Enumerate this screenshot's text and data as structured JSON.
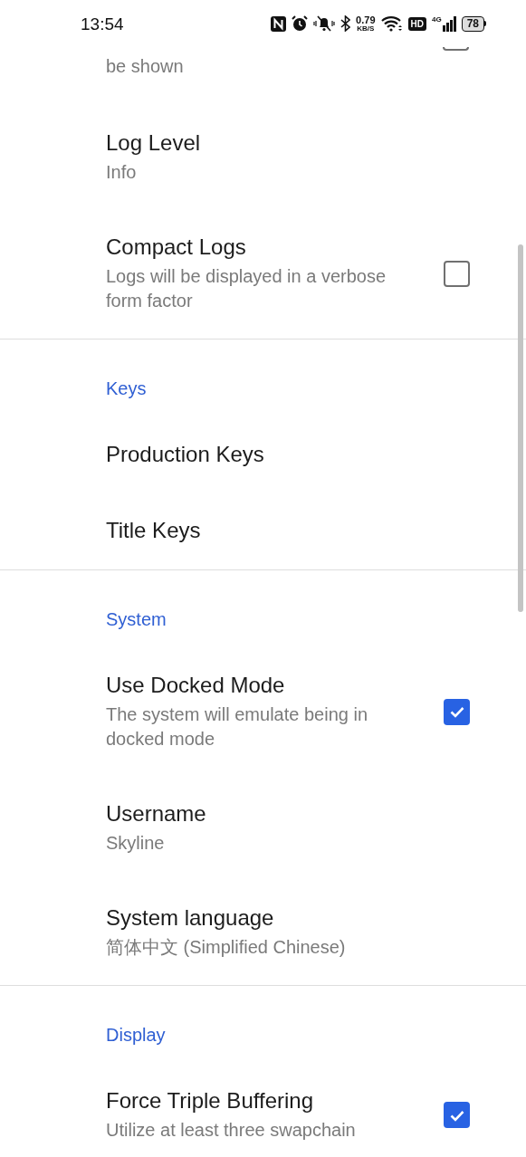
{
  "status_bar": {
    "time": "13:54",
    "net_speed": "0.79",
    "net_speed_unit": "KB/S",
    "hd_badge": "HD",
    "network_type": "4G",
    "battery": "78"
  },
  "top_partial": {
    "subtitle_tail": "be shown",
    "checked": false
  },
  "sections": [
    {
      "items": [
        {
          "kind": "value",
          "title": "Log Level",
          "subtitle": "Info"
        },
        {
          "kind": "checkbox",
          "title": "Compact Logs",
          "subtitle": "Logs will be displayed in a verbose form factor",
          "checked": false
        }
      ]
    },
    {
      "header": "Keys",
      "items": [
        {
          "kind": "link",
          "title": "Production Keys"
        },
        {
          "kind": "link",
          "title": "Title Keys"
        }
      ]
    },
    {
      "header": "System",
      "items": [
        {
          "kind": "checkbox",
          "title": "Use Docked Mode",
          "subtitle": "The system will emulate being in docked mode",
          "checked": true
        },
        {
          "kind": "value",
          "title": "Username",
          "subtitle": "Skyline"
        },
        {
          "kind": "value",
          "title": "System language",
          "subtitle": "简体中文 (Simplified Chinese)"
        }
      ]
    },
    {
      "header": "Display",
      "items": [
        {
          "kind": "checkbox",
          "title": "Force Triple Buffering",
          "subtitle": "Utilize at least three swapchain",
          "checked": true
        }
      ]
    }
  ]
}
